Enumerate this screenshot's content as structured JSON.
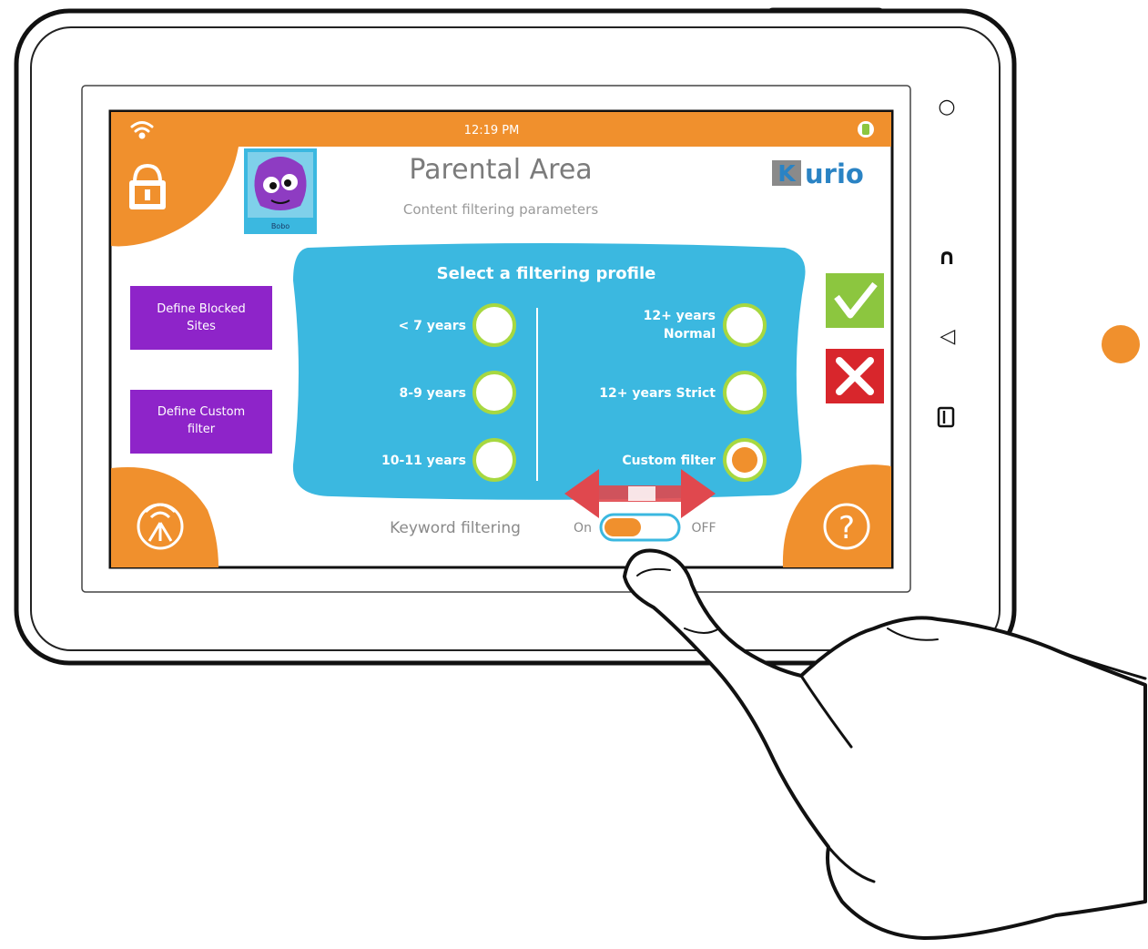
{
  "status_bar": {
    "time": "12:19 PM"
  },
  "header": {
    "title": "Parental Area",
    "subtitle": "Content filtering parameters",
    "brand": "urio",
    "brand_letter": "K"
  },
  "profile": {
    "avatar_caption": "Bobo"
  },
  "sidebar": {
    "buttons": [
      {
        "line1": "Define Blocked",
        "line2": "Sites"
      },
      {
        "line1": "Define Custom",
        "line2": "filter"
      }
    ]
  },
  "filter_panel": {
    "title": "Select a filtering profile",
    "left_options": [
      {
        "label": "< 7 years",
        "selected": false
      },
      {
        "label": "8-9 years",
        "selected": false
      },
      {
        "label": "10-11 years",
        "selected": false
      }
    ],
    "right_options": [
      {
        "line1": "12+ years",
        "line2": "Normal",
        "selected": false
      },
      {
        "line1": "12+ years Strict",
        "line2": "",
        "selected": false
      },
      {
        "line1": "Custom filter",
        "line2": "",
        "selected": true
      }
    ]
  },
  "keyword_filtering": {
    "label": "Keyword filtering",
    "on_label": "On",
    "off_label": "OFF",
    "state": "on"
  },
  "device_buttons": {
    "top_glyph": "○",
    "mid_glyph": "∩",
    "bottom_glyph": "◁"
  },
  "help": {
    "glyph": "?"
  },
  "colors": {
    "orange": "#f0902d",
    "purple": "#8e24c9",
    "panel_blue": "#3bb8e0",
    "green": "#8cc63f",
    "red": "#d8262c",
    "brand_blue": "#2a83c4"
  },
  "icons": [
    "wifi-icon",
    "lock-icon",
    "battery-icon",
    "antenna-icon",
    "help-icon",
    "check-icon",
    "close-icon",
    "swipe-arrow-icon",
    "pointing-hand-icon"
  ]
}
